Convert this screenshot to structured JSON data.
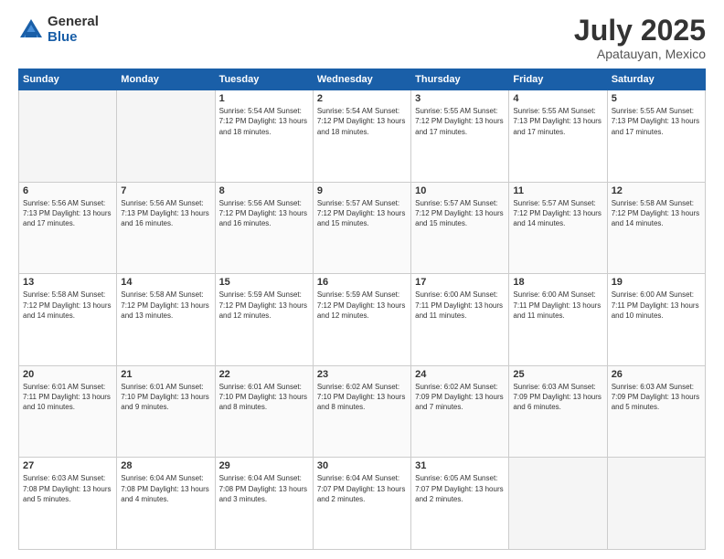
{
  "logo": {
    "general": "General",
    "blue": "Blue"
  },
  "header": {
    "month": "July 2025",
    "location": "Apatauyan, Mexico"
  },
  "weekdays": [
    "Sunday",
    "Monday",
    "Tuesday",
    "Wednesday",
    "Thursday",
    "Friday",
    "Saturday"
  ],
  "weeks": [
    [
      {
        "day": "",
        "info": ""
      },
      {
        "day": "",
        "info": ""
      },
      {
        "day": "1",
        "info": "Sunrise: 5:54 AM\nSunset: 7:12 PM\nDaylight: 13 hours\nand 18 minutes."
      },
      {
        "day": "2",
        "info": "Sunrise: 5:54 AM\nSunset: 7:12 PM\nDaylight: 13 hours\nand 18 minutes."
      },
      {
        "day": "3",
        "info": "Sunrise: 5:55 AM\nSunset: 7:12 PM\nDaylight: 13 hours\nand 17 minutes."
      },
      {
        "day": "4",
        "info": "Sunrise: 5:55 AM\nSunset: 7:13 PM\nDaylight: 13 hours\nand 17 minutes."
      },
      {
        "day": "5",
        "info": "Sunrise: 5:55 AM\nSunset: 7:13 PM\nDaylight: 13 hours\nand 17 minutes."
      }
    ],
    [
      {
        "day": "6",
        "info": "Sunrise: 5:56 AM\nSunset: 7:13 PM\nDaylight: 13 hours\nand 17 minutes."
      },
      {
        "day": "7",
        "info": "Sunrise: 5:56 AM\nSunset: 7:13 PM\nDaylight: 13 hours\nand 16 minutes."
      },
      {
        "day": "8",
        "info": "Sunrise: 5:56 AM\nSunset: 7:12 PM\nDaylight: 13 hours\nand 16 minutes."
      },
      {
        "day": "9",
        "info": "Sunrise: 5:57 AM\nSunset: 7:12 PM\nDaylight: 13 hours\nand 15 minutes."
      },
      {
        "day": "10",
        "info": "Sunrise: 5:57 AM\nSunset: 7:12 PM\nDaylight: 13 hours\nand 15 minutes."
      },
      {
        "day": "11",
        "info": "Sunrise: 5:57 AM\nSunset: 7:12 PM\nDaylight: 13 hours\nand 14 minutes."
      },
      {
        "day": "12",
        "info": "Sunrise: 5:58 AM\nSunset: 7:12 PM\nDaylight: 13 hours\nand 14 minutes."
      }
    ],
    [
      {
        "day": "13",
        "info": "Sunrise: 5:58 AM\nSunset: 7:12 PM\nDaylight: 13 hours\nand 14 minutes."
      },
      {
        "day": "14",
        "info": "Sunrise: 5:58 AM\nSunset: 7:12 PM\nDaylight: 13 hours\nand 13 minutes."
      },
      {
        "day": "15",
        "info": "Sunrise: 5:59 AM\nSunset: 7:12 PM\nDaylight: 13 hours\nand 12 minutes."
      },
      {
        "day": "16",
        "info": "Sunrise: 5:59 AM\nSunset: 7:12 PM\nDaylight: 13 hours\nand 12 minutes."
      },
      {
        "day": "17",
        "info": "Sunrise: 6:00 AM\nSunset: 7:11 PM\nDaylight: 13 hours\nand 11 minutes."
      },
      {
        "day": "18",
        "info": "Sunrise: 6:00 AM\nSunset: 7:11 PM\nDaylight: 13 hours\nand 11 minutes."
      },
      {
        "day": "19",
        "info": "Sunrise: 6:00 AM\nSunset: 7:11 PM\nDaylight: 13 hours\nand 10 minutes."
      }
    ],
    [
      {
        "day": "20",
        "info": "Sunrise: 6:01 AM\nSunset: 7:11 PM\nDaylight: 13 hours\nand 10 minutes."
      },
      {
        "day": "21",
        "info": "Sunrise: 6:01 AM\nSunset: 7:10 PM\nDaylight: 13 hours\nand 9 minutes."
      },
      {
        "day": "22",
        "info": "Sunrise: 6:01 AM\nSunset: 7:10 PM\nDaylight: 13 hours\nand 8 minutes."
      },
      {
        "day": "23",
        "info": "Sunrise: 6:02 AM\nSunset: 7:10 PM\nDaylight: 13 hours\nand 8 minutes."
      },
      {
        "day": "24",
        "info": "Sunrise: 6:02 AM\nSunset: 7:09 PM\nDaylight: 13 hours\nand 7 minutes."
      },
      {
        "day": "25",
        "info": "Sunrise: 6:03 AM\nSunset: 7:09 PM\nDaylight: 13 hours\nand 6 minutes."
      },
      {
        "day": "26",
        "info": "Sunrise: 6:03 AM\nSunset: 7:09 PM\nDaylight: 13 hours\nand 5 minutes."
      }
    ],
    [
      {
        "day": "27",
        "info": "Sunrise: 6:03 AM\nSunset: 7:08 PM\nDaylight: 13 hours\nand 5 minutes."
      },
      {
        "day": "28",
        "info": "Sunrise: 6:04 AM\nSunset: 7:08 PM\nDaylight: 13 hours\nand 4 minutes."
      },
      {
        "day": "29",
        "info": "Sunrise: 6:04 AM\nSunset: 7:08 PM\nDaylight: 13 hours\nand 3 minutes."
      },
      {
        "day": "30",
        "info": "Sunrise: 6:04 AM\nSunset: 7:07 PM\nDaylight: 13 hours\nand 2 minutes."
      },
      {
        "day": "31",
        "info": "Sunrise: 6:05 AM\nSunset: 7:07 PM\nDaylight: 13 hours\nand 2 minutes."
      },
      {
        "day": "",
        "info": ""
      },
      {
        "day": "",
        "info": ""
      }
    ]
  ]
}
